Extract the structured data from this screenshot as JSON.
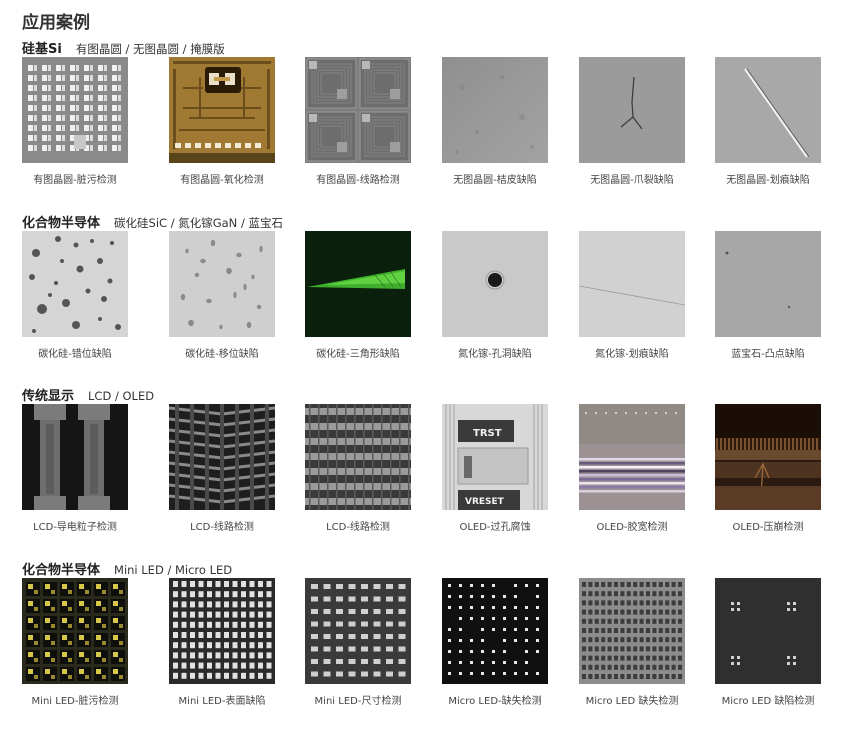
{
  "page": {
    "title": "应用案例"
  },
  "sections": [
    {
      "title": "硅基Si",
      "subtitle": "有图晶圆 / 无图晶圆 / 掩膜版",
      "items": [
        {
          "caption": "有图晶圆-脏污检测",
          "icon": "wafer-grid-image"
        },
        {
          "caption": "有图晶圆-氧化检测",
          "icon": "wafer-oxidation-image"
        },
        {
          "caption": "有图晶圆-线路检测",
          "icon": "wafer-circuit-image"
        },
        {
          "caption": "无图晶圆-桔皮缺陷",
          "icon": "orange-peel-image"
        },
        {
          "caption": "无图晶圆-爪裂缺陷",
          "icon": "claw-crack-image"
        },
        {
          "caption": "无图晶圆-划痕缺陷",
          "icon": "scratch-image"
        }
      ]
    },
    {
      "title": "化合物半导体",
      "subtitle": "碳化硅SiC / 氮化镓GaN / 蓝宝石",
      "items": [
        {
          "caption": "碳化硅-错位缺陷",
          "icon": "sic-dislocation-image"
        },
        {
          "caption": "碳化硅-移位缺陷",
          "icon": "sic-shift-image"
        },
        {
          "caption": "碳化硅-三角形缺陷",
          "icon": "sic-triangle-image"
        },
        {
          "caption": "氮化镓-孔洞缺陷",
          "icon": "gan-hole-image"
        },
        {
          "caption": "氮化镓-划痕缺陷",
          "icon": "gan-scratch-image"
        },
        {
          "caption": "蓝宝石-凸点缺陷",
          "icon": "sapphire-bump-image"
        }
      ]
    },
    {
      "title": "传统显示",
      "subtitle": "LCD / OLED",
      "items": [
        {
          "caption": "LCD-导电粒子检测",
          "icon": "lcd-particle-image"
        },
        {
          "caption": "LCD-线路检测",
          "icon": "lcd-chevron-circuit-image"
        },
        {
          "caption": "LCD-线路检测",
          "icon": "lcd-stripe-circuit-image"
        },
        {
          "caption": "OLED-过孔腐蚀",
          "icon": "oled-via-image",
          "labels": [
            "TRST",
            "VRESET"
          ]
        },
        {
          "caption": "OLED-胶宽检测",
          "icon": "oled-glue-image"
        },
        {
          "caption": "OLED-压崩检测",
          "icon": "oled-crush-image"
        }
      ]
    },
    {
      "title": "化合物半导体",
      "subtitle": "Mini LED / Micro LED",
      "items": [
        {
          "caption": "Mini LED-脏污检测",
          "icon": "mini-led-dirt-image"
        },
        {
          "caption": "Mini LED-表面缺陷",
          "icon": "mini-led-surface-image"
        },
        {
          "caption": "Mini LED-尺寸检测",
          "icon": "mini-led-size-image"
        },
        {
          "caption": "Micro LED-缺失检测",
          "icon": "micro-led-missing-image"
        },
        {
          "caption": "Micro LED 缺失检测",
          "icon": "micro-led-missing2-image"
        },
        {
          "caption": "Micro LED 缺陷检测",
          "icon": "micro-led-defect-image"
        }
      ]
    }
  ]
}
